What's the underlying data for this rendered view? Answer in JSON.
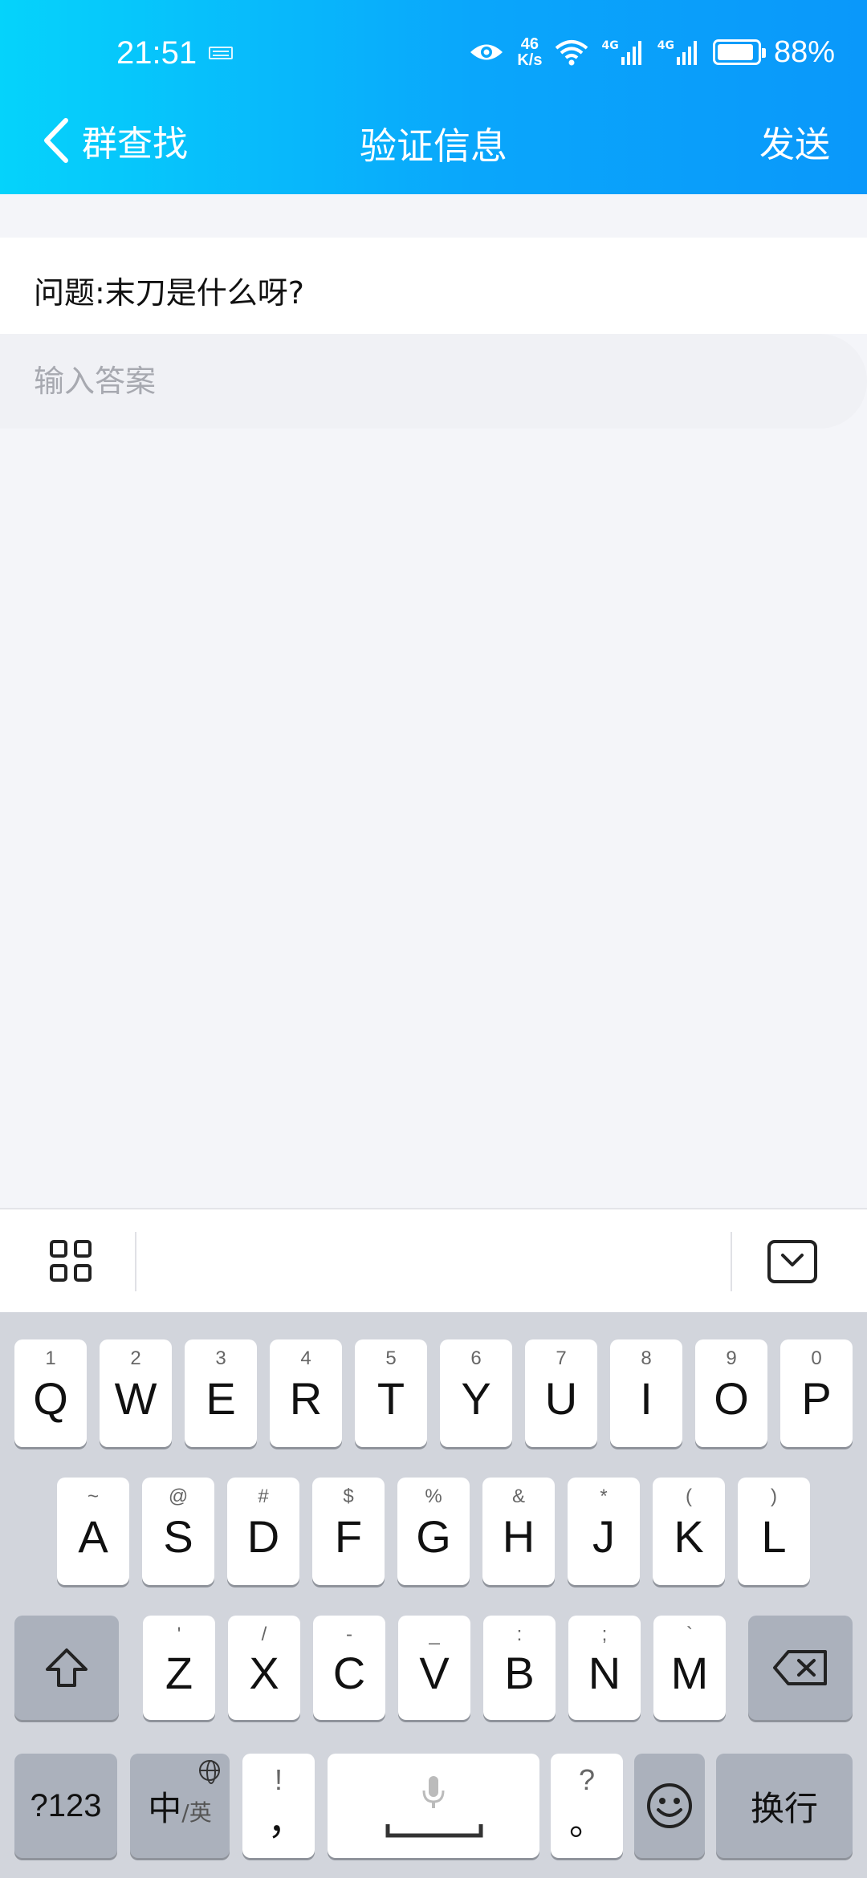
{
  "status_bar": {
    "time": "21:51",
    "net_speed_value": "46",
    "net_speed_unit": "K/s",
    "network1": "4G",
    "network2": "4G",
    "battery": "88%"
  },
  "nav": {
    "back_label": "群查找",
    "title": "验证信息",
    "send_label": "发送"
  },
  "question": {
    "text": "问题:末刀是什么呀?"
  },
  "answer": {
    "placeholder": "输入答案",
    "value": ""
  },
  "keyboard": {
    "row1": [
      {
        "main": "Q",
        "sub": "1"
      },
      {
        "main": "W",
        "sub": "2"
      },
      {
        "main": "E",
        "sub": "3"
      },
      {
        "main": "R",
        "sub": "4"
      },
      {
        "main": "T",
        "sub": "5"
      },
      {
        "main": "Y",
        "sub": "6"
      },
      {
        "main": "U",
        "sub": "7"
      },
      {
        "main": "I",
        "sub": "8"
      },
      {
        "main": "O",
        "sub": "9"
      },
      {
        "main": "P",
        "sub": "0"
      }
    ],
    "row2": [
      {
        "main": "A",
        "sub": "~"
      },
      {
        "main": "S",
        "sub": "@"
      },
      {
        "main": "D",
        "sub": "#"
      },
      {
        "main": "F",
        "sub": "$"
      },
      {
        "main": "G",
        "sub": "%"
      },
      {
        "main": "H",
        "sub": "&"
      },
      {
        "main": "J",
        "sub": "*"
      },
      {
        "main": "K",
        "sub": "("
      },
      {
        "main": "L",
        "sub": ")"
      }
    ],
    "row3": [
      {
        "main": "Z",
        "sub": "'"
      },
      {
        "main": "X",
        "sub": "/"
      },
      {
        "main": "C",
        "sub": "-"
      },
      {
        "main": "V",
        "sub": "_"
      },
      {
        "main": "B",
        "sub": ":"
      },
      {
        "main": "N",
        "sub": ";"
      },
      {
        "main": "M",
        "sub": "`"
      }
    ],
    "symbols_label": "?123",
    "lang_main": "中",
    "lang_alt": "/英",
    "comma_main": "，",
    "comma_sub": "!",
    "period_main": "。",
    "period_sub": "?",
    "enter_label": "换行"
  }
}
